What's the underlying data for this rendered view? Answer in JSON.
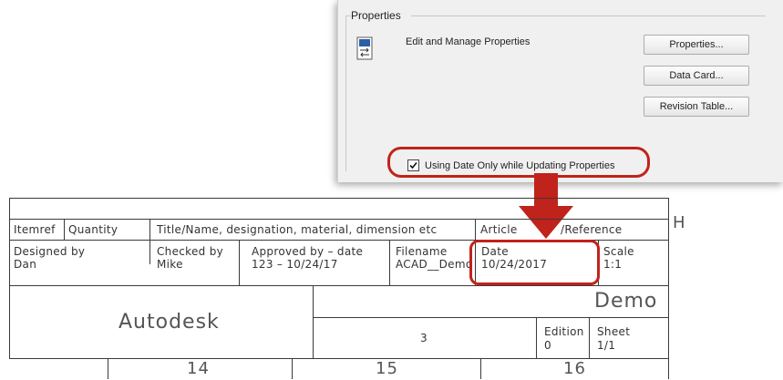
{
  "properties_panel": {
    "group_title": "Properties",
    "edit_label": "Edit and Manage Properties",
    "buttons": {
      "properties": "Properties...",
      "data_card": "Data Card...",
      "revision_table": "Revision Table..."
    },
    "checkbox_label": "Using Date Only while Updating Properties",
    "checkbox_checked": true,
    "highlight_color": "#c0231b"
  },
  "title_block": {
    "header": {
      "itemref": "Itemref",
      "quantity": "Quantity",
      "title": "Title/Name, designation, material, dimension etc",
      "article_prefix": "Article",
      "article_suffix": "/Reference",
      "side_letter": "H"
    },
    "designed_by_label": "Designed by",
    "designed_by_value": "Dan",
    "checked_by_label": "Checked by",
    "checked_by_value": "Mike",
    "approved_label": "Approved by – date",
    "approved_value": "123 – 10/24/17",
    "filename_label": "Filename",
    "filename_value": "ACAD__Demo",
    "date_label": "Date",
    "date_value": "10/24/2017",
    "scale_label": "Scale",
    "scale_value": "1:1",
    "company": "Autodesk",
    "drawing_title": "Demo",
    "drawing_number": "3",
    "edition_label": "Edition",
    "edition_value": "0",
    "sheet_label": "Sheet",
    "sheet_value": "1/1",
    "zones": [
      "14",
      "15",
      "16"
    ]
  },
  "arrow_color": "#c0231b"
}
